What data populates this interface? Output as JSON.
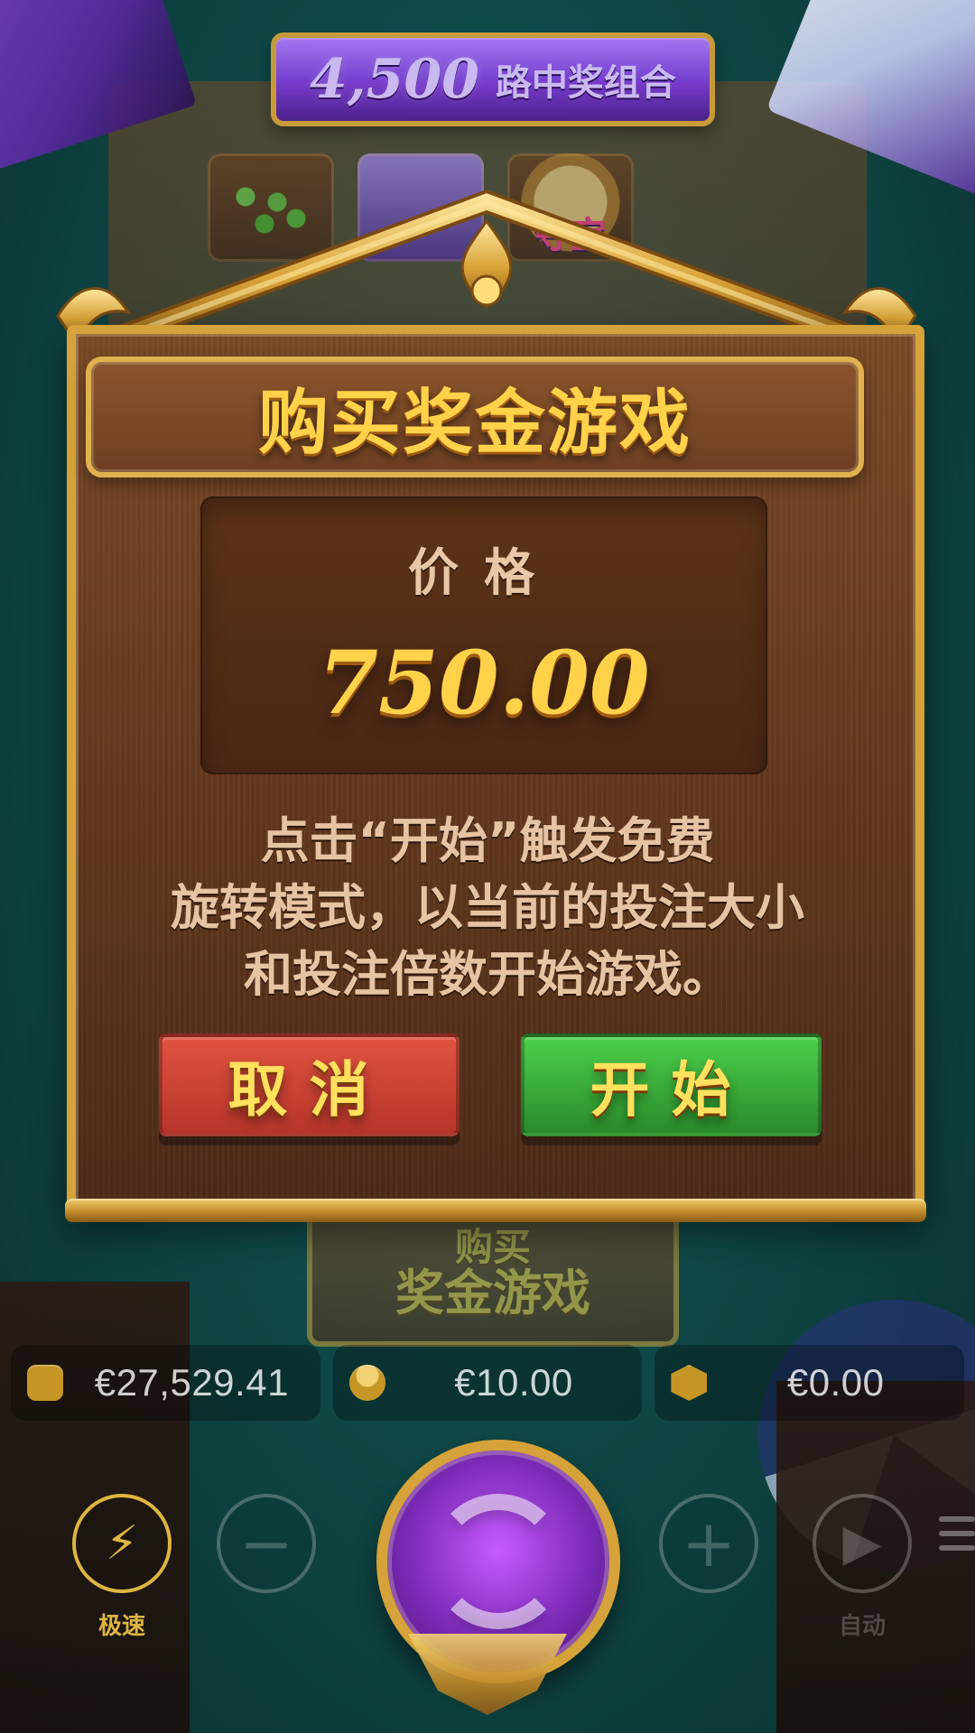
{
  "background": {
    "ways_banner": {
      "number": "4,500",
      "text": "路中奖组合"
    },
    "top_symbol_text": "夺宝",
    "buy_plaque": {
      "top": "购买",
      "bottom": "奖金游戏"
    }
  },
  "modal": {
    "title": "购买奖金游戏",
    "price_label": "价格",
    "price_value": "750.00",
    "description": "点击“开始”触发免费\n旋转模式，以当前的投注大小\n和投注倍数开始游戏。",
    "buttons": {
      "cancel": "取消",
      "start": "开始"
    }
  },
  "stats": {
    "balance": "€27,529.41",
    "bet": "€10.00",
    "win": "€0.00"
  },
  "controls": {
    "turbo_label": "极速",
    "auto_label": "自动"
  },
  "icons": {
    "wallet": "wallet-icon",
    "coins": "coins-icon",
    "prize": "prize-icon",
    "turbo": "lightning-icon",
    "minus": "minus-icon",
    "plus": "plus-icon",
    "auto": "play-icon",
    "menu": "menu-icon",
    "spin": "spin-icon"
  },
  "colors": {
    "gold": "#d6a23a",
    "title_gold": "#ffd24a",
    "cancel_red": "#c83d2f",
    "start_green": "#35a837",
    "panel_brown": "#5a331b"
  }
}
